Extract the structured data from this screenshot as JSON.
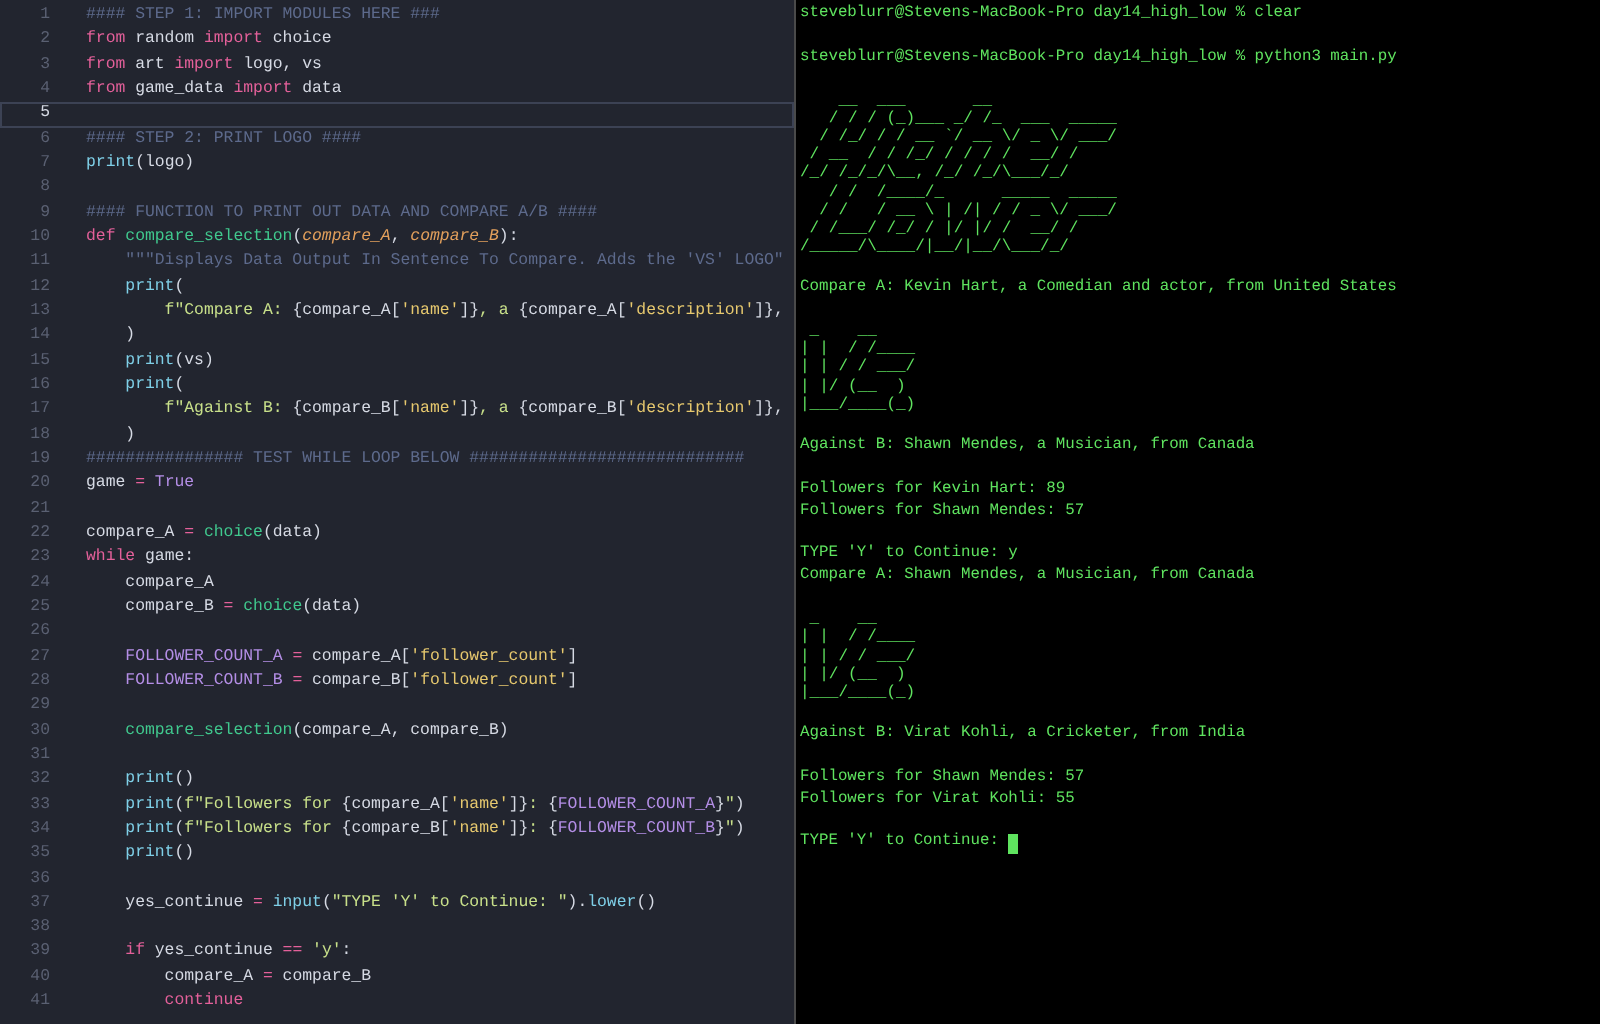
{
  "editor": {
    "lines": [
      {
        "number": "1",
        "current": false,
        "tokens": [
          {
            "kind": "c",
            "text": "#### STEP 1: IMPORT MODULES HERE ###"
          }
        ]
      },
      {
        "number": "2",
        "current": false,
        "tokens": [
          {
            "kind": "k",
            "text": "from"
          },
          {
            "kind": "p",
            "text": " random "
          },
          {
            "kind": "k",
            "text": "import"
          },
          {
            "kind": "p",
            "text": " choice"
          }
        ]
      },
      {
        "number": "3",
        "current": false,
        "tokens": [
          {
            "kind": "k",
            "text": "from"
          },
          {
            "kind": "p",
            "text": " art "
          },
          {
            "kind": "k",
            "text": "import"
          },
          {
            "kind": "p",
            "text": " logo, vs"
          }
        ]
      },
      {
        "number": "4",
        "current": false,
        "tokens": [
          {
            "kind": "k",
            "text": "from"
          },
          {
            "kind": "p",
            "text": " game_data "
          },
          {
            "kind": "k",
            "text": "import"
          },
          {
            "kind": "p",
            "text": " data"
          }
        ]
      },
      {
        "number": "5",
        "current": true
      },
      {
        "number": "6",
        "current": false,
        "tokens": [
          {
            "kind": "c",
            "text": "#### STEP 2: PRINT LOGO ####"
          }
        ]
      },
      {
        "number": "7",
        "current": false,
        "tokens": [
          {
            "kind": "b",
            "text": "print"
          },
          {
            "kind": "p",
            "text": "(logo)"
          }
        ]
      },
      {
        "number": "8",
        "current": false
      },
      {
        "number": "9",
        "current": false,
        "tokens": [
          {
            "kind": "c",
            "text": "#### FUNCTION TO PRINT OUT DATA AND COMPARE A/B ####"
          }
        ]
      },
      {
        "number": "10",
        "current": false,
        "tokens": [
          {
            "kind": "k",
            "text": "def "
          },
          {
            "kind": "f",
            "text": "compare_selection"
          },
          {
            "kind": "p",
            "text": "("
          },
          {
            "kind": "a",
            "text": "compare_A"
          },
          {
            "kind": "p",
            "text": ", "
          },
          {
            "kind": "a",
            "text": "compare_B"
          },
          {
            "kind": "p",
            "text": "):"
          }
        ]
      },
      {
        "number": "11",
        "current": false,
        "tokens": [
          {
            "kind": "c",
            "text": "    \"\"\"Displays Data Output In Sentence To Compare. Adds the 'VS' LOGO\""
          }
        ]
      },
      {
        "number": "12",
        "current": false,
        "tokens": [
          {
            "kind": "b",
            "text": "    print"
          },
          {
            "kind": "p",
            "text": "("
          }
        ]
      },
      {
        "number": "13",
        "current": false,
        "tokens": [
          {
            "kind": "s",
            "text": "        f\"Compare A: "
          },
          {
            "kind": "p",
            "text": "{compare_A["
          },
          {
            "kind": "q",
            "text": "'name'"
          },
          {
            "kind": "p",
            "text": "]}"
          },
          {
            "kind": "s",
            "text": ", a "
          },
          {
            "kind": "p",
            "text": "{compare_A["
          },
          {
            "kind": "q",
            "text": "'description'"
          },
          {
            "kind": "p",
            "text": "]},"
          }
        ]
      },
      {
        "number": "14",
        "current": false,
        "tokens": [
          {
            "kind": "p",
            "text": "    )"
          }
        ]
      },
      {
        "number": "15",
        "current": false,
        "tokens": [
          {
            "kind": "b",
            "text": "    print"
          },
          {
            "kind": "p",
            "text": "(vs)"
          }
        ]
      },
      {
        "number": "16",
        "current": false,
        "tokens": [
          {
            "kind": "b",
            "text": "    print"
          },
          {
            "kind": "p",
            "text": "("
          }
        ]
      },
      {
        "number": "17",
        "current": false,
        "tokens": [
          {
            "kind": "s",
            "text": "        f\"Against B: "
          },
          {
            "kind": "p",
            "text": "{compare_B["
          },
          {
            "kind": "q",
            "text": "'name'"
          },
          {
            "kind": "p",
            "text": "]}"
          },
          {
            "kind": "s",
            "text": ", a "
          },
          {
            "kind": "p",
            "text": "{compare_B["
          },
          {
            "kind": "q",
            "text": "'description'"
          },
          {
            "kind": "p",
            "text": "]},"
          }
        ]
      },
      {
        "number": "18",
        "current": false,
        "tokens": [
          {
            "kind": "p",
            "text": "    )"
          }
        ]
      },
      {
        "number": "19",
        "current": false,
        "tokens": [
          {
            "kind": "c",
            "text": "################ TEST WHILE LOOP BELOW ############################"
          }
        ]
      },
      {
        "number": "20",
        "current": false,
        "tokens": [
          {
            "kind": "p",
            "text": "game "
          },
          {
            "kind": "o",
            "text": "= "
          },
          {
            "kind": "v",
            "text": "True"
          }
        ]
      },
      {
        "number": "21",
        "current": false
      },
      {
        "number": "22",
        "current": false,
        "tokens": [
          {
            "kind": "p",
            "text": "compare_A "
          },
          {
            "kind": "o",
            "text": "= "
          },
          {
            "kind": "f",
            "text": "choice"
          },
          {
            "kind": "p",
            "text": "(data)"
          }
        ]
      },
      {
        "number": "23",
        "current": false,
        "tokens": [
          {
            "kind": "k",
            "text": "while"
          },
          {
            "kind": "p",
            "text": " game:"
          }
        ]
      },
      {
        "number": "24",
        "current": false,
        "tokens": [
          {
            "kind": "p",
            "text": "    compare_A"
          }
        ]
      },
      {
        "number": "25",
        "current": false,
        "tokens": [
          {
            "kind": "p",
            "text": "    compare_B "
          },
          {
            "kind": "o",
            "text": "= "
          },
          {
            "kind": "f",
            "text": "choice"
          },
          {
            "kind": "p",
            "text": "(data)"
          }
        ]
      },
      {
        "number": "26",
        "current": false
      },
      {
        "number": "27",
        "current": false,
        "tokens": [
          {
            "kind": "v",
            "text": "    FOLLOWER_COUNT_A "
          },
          {
            "kind": "o",
            "text": "="
          },
          {
            "kind": "p",
            "text": " compare_A["
          },
          {
            "kind": "q",
            "text": "'follower_count'"
          },
          {
            "kind": "p",
            "text": "]"
          }
        ]
      },
      {
        "number": "28",
        "current": false,
        "tokens": [
          {
            "kind": "v",
            "text": "    FOLLOWER_COUNT_B "
          },
          {
            "kind": "o",
            "text": "="
          },
          {
            "kind": "p",
            "text": " compare_B["
          },
          {
            "kind": "q",
            "text": "'follower_count'"
          },
          {
            "kind": "p",
            "text": "]"
          }
        ]
      },
      {
        "number": "29",
        "current": false
      },
      {
        "number": "30",
        "current": false,
        "tokens": [
          {
            "kind": "f",
            "text": "    compare_selection"
          },
          {
            "kind": "p",
            "text": "(compare_A, compare_B)"
          }
        ]
      },
      {
        "number": "31",
        "current": false
      },
      {
        "number": "32",
        "current": false,
        "tokens": [
          {
            "kind": "b",
            "text": "    print"
          },
          {
            "kind": "p",
            "text": "()"
          }
        ]
      },
      {
        "number": "33",
        "current": false,
        "tokens": [
          {
            "kind": "b",
            "text": "    print"
          },
          {
            "kind": "p",
            "text": "("
          },
          {
            "kind": "s",
            "text": "f\"Followers for "
          },
          {
            "kind": "p",
            "text": "{compare_A["
          },
          {
            "kind": "q",
            "text": "'name'"
          },
          {
            "kind": "p",
            "text": "]}"
          },
          {
            "kind": "s",
            "text": ": "
          },
          {
            "kind": "p",
            "text": "{"
          },
          {
            "kind": "v",
            "text": "FOLLOWER_COUNT_A"
          },
          {
            "kind": "p",
            "text": "}"
          },
          {
            "kind": "s",
            "text": "\""
          },
          {
            "kind": "p",
            "text": ")"
          }
        ]
      },
      {
        "number": "34",
        "current": false,
        "tokens": [
          {
            "kind": "b",
            "text": "    print"
          },
          {
            "kind": "p",
            "text": "("
          },
          {
            "kind": "s",
            "text": "f\"Followers for "
          },
          {
            "kind": "p",
            "text": "{compare_B["
          },
          {
            "kind": "q",
            "text": "'name'"
          },
          {
            "kind": "p",
            "text": "]}"
          },
          {
            "kind": "s",
            "text": ": "
          },
          {
            "kind": "p",
            "text": "{"
          },
          {
            "kind": "v",
            "text": "FOLLOWER_COUNT_B"
          },
          {
            "kind": "p",
            "text": "}"
          },
          {
            "kind": "s",
            "text": "\""
          },
          {
            "kind": "p",
            "text": ")"
          }
        ]
      },
      {
        "number": "35",
        "current": false,
        "tokens": [
          {
            "kind": "b",
            "text": "    print"
          },
          {
            "kind": "p",
            "text": "()"
          }
        ]
      },
      {
        "number": "36",
        "current": false
      },
      {
        "number": "37",
        "current": false,
        "tokens": [
          {
            "kind": "p",
            "text": "    yes_continue "
          },
          {
            "kind": "o",
            "text": "= "
          },
          {
            "kind": "b",
            "text": "input"
          },
          {
            "kind": "p",
            "text": "("
          },
          {
            "kind": "s",
            "text": "\"TYPE 'Y' to Continue: \""
          },
          {
            "kind": "p",
            "text": ")."
          },
          {
            "kind": "b",
            "text": "lower"
          },
          {
            "kind": "p",
            "text": "()"
          }
        ]
      },
      {
        "number": "38",
        "current": false
      },
      {
        "number": "39",
        "current": false,
        "tokens": [
          {
            "kind": "k",
            "text": "    if"
          },
          {
            "kind": "p",
            "text": " yes_continue "
          },
          {
            "kind": "o",
            "text": "== "
          },
          {
            "kind": "s",
            "text": "'y'"
          },
          {
            "kind": "p",
            "text": ":"
          }
        ]
      },
      {
        "number": "40",
        "current": false,
        "tokens": [
          {
            "kind": "p",
            "text": "        compare_A "
          },
          {
            "kind": "o",
            "text": "="
          },
          {
            "kind": "p",
            "text": " compare_B"
          }
        ]
      },
      {
        "number": "41",
        "current": false,
        "tokens": [
          {
            "kind": "k",
            "text": "        continue"
          }
        ]
      }
    ]
  },
  "terminal": {
    "lines": [
      {
        "kind": "text",
        "text": "steveblurr@Stevens-MacBook-Pro day14_high_low % clear"
      },
      {
        "kind": "gap"
      },
      {
        "kind": "text",
        "text": "steveblurr@Stevens-MacBook-Pro day14_high_low % python3 main.py"
      },
      {
        "kind": "gap"
      },
      {
        "kind": "art",
        "text": "    __  ___       __\n   / / / (_)___ _/ /_  ___  _____\n  / /_/ / / __ `/ __ \\/ _ \\/ ___/\n / __  / / /_/ / / / /  __/ /\n/_/ /_/_/\\__, /_/ /_/\\___/_/\n   / /  /____/_      _____  _____\n  / /   / __ \\ | /| / / _ \\/ ___/\n / /___/ /_/ / |/ |/ /  __/ /\n/_____/\\____/|__/|__/\\___/_/"
      },
      {
        "kind": "gap"
      },
      {
        "kind": "text",
        "text": "Compare A: Kevin Hart, a Comedian and actor, from United States"
      },
      {
        "kind": "gap"
      },
      {
        "kind": "art",
        "text": " _    __\n| |  / /____\n| | / / ___/\n| |/ (__  )\n|___/____(_)"
      },
      {
        "kind": "gap"
      },
      {
        "kind": "text",
        "text": "Against B: Shawn Mendes, a Musician, from Canada"
      },
      {
        "kind": "gap"
      },
      {
        "kind": "text",
        "text": "Followers for Kevin Hart: 89"
      },
      {
        "kind": "text",
        "text": "Followers for Shawn Mendes: 57"
      },
      {
        "kind": "gap"
      },
      {
        "kind": "text",
        "text": "TYPE 'Y' to Continue: y"
      },
      {
        "kind": "text",
        "text": "Compare A: Shawn Mendes, a Musician, from Canada"
      },
      {
        "kind": "gap"
      },
      {
        "kind": "art",
        "text": " _    __\n| |  / /____\n| | / / ___/\n| |/ (__  )\n|___/____(_)"
      },
      {
        "kind": "gap"
      },
      {
        "kind": "text",
        "text": "Against B: Virat Kohli, a Cricketer, from India"
      },
      {
        "kind": "gap"
      },
      {
        "kind": "text",
        "text": "Followers for Shawn Mendes: 57"
      },
      {
        "kind": "text",
        "text": "Followers for Virat Kohli: 55"
      },
      {
        "kind": "gap"
      },
      {
        "kind": "input",
        "text": "TYPE 'Y' to Continue:",
        "cursor": true
      }
    ]
  }
}
